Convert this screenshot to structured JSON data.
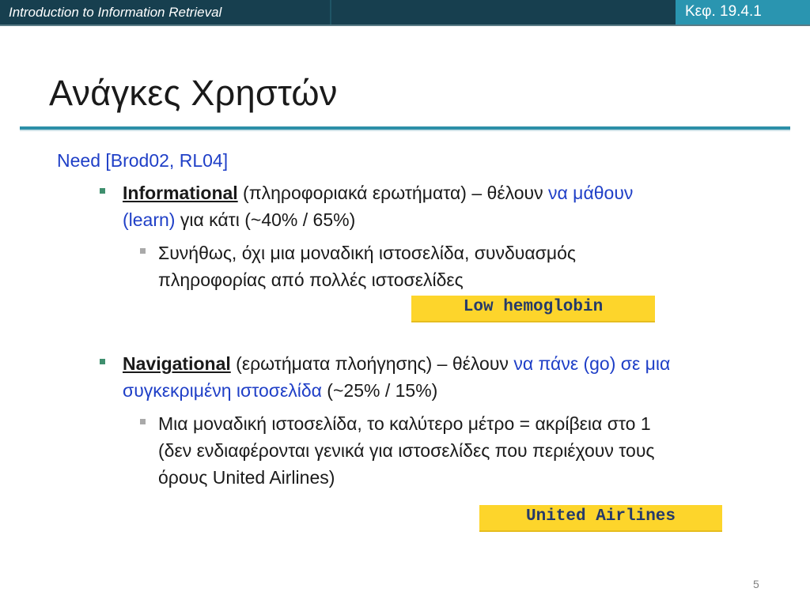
{
  "header": {
    "course_title": "Introduction to Information Retrieval",
    "chapter_ref": "Κεφ. 19.4.1"
  },
  "slide": {
    "title": "Ανάγκες Χρηστών",
    "need_line": "Need [Brod02, RL04]",
    "informational": {
      "term": "Informational",
      "desc": " (πληροφοριακά ερωτήματα) – θέλουν ",
      "highlight": "να μάθουν",
      "line2_highlight": "(learn)",
      "line2_rest": " για κάτι (~40% / 65%)",
      "sub_line1": "Συνήθως, όχι μια μοναδική ιστοσελίδα, συνδυασμός",
      "sub_line2": "πληροφορίας από πολλές ιστοσελίδες",
      "example_query": "Low hemoglobin"
    },
    "navigational": {
      "term": "Navigational",
      "desc": " (ερωτήματα πλοήγησης) – θέλουν ",
      "highlight": "να πάνε (go) σε μια",
      "line2_highlight": "συγκεκριμένη ιστοσελίδα",
      "line2_rest": " (~25% / 15%)",
      "sub_line1": "Μια μοναδική ιστοσελίδα, το καλύτερο μέτρο = ακρίβεια στο 1",
      "sub_line2": "(δεν ενδιαφέρονται γενικά για ιστοσελίδες που περιέχουν τους",
      "sub_line3": "όρους United Airlines)",
      "example_query": "United Airlines"
    },
    "page_number": "5"
  },
  "colors": {
    "header_bg": "#173f4f",
    "chapter_bg": "#2a95b0",
    "rule": "#2c8fa8",
    "link_blue": "#1f3fc7",
    "query_box": "#fdd52b",
    "bullet_l1": "#3f8f6e",
    "bullet_l2": "#a9a9a9"
  }
}
